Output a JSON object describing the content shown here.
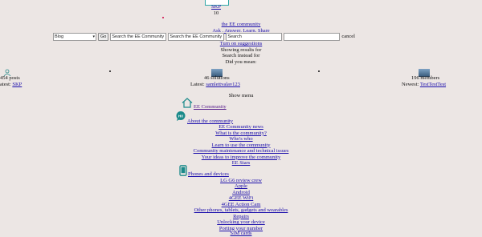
{
  "top": {
    "profile_link": "SKP",
    "profile_count": "10"
  },
  "community": {
    "title_link": "the EE community",
    "tagline": "Ask . Answer. Learn. Share"
  },
  "search": {
    "scope_selected": "Blog",
    "go_label": "Go",
    "field1_value": "Search the EE Community",
    "field2_value": "Search the EE Community",
    "field3_placeholder": "Search",
    "cancel_label": "cancel"
  },
  "suggestions": {
    "toggle_link": "Turn on suggestions",
    "showing_results": "Showing results for",
    "search_instead": "Search instead for",
    "did_you_mean": "Did you mean:"
  },
  "stats": {
    "posts": "454 posts",
    "latest_label_left": "atest:",
    "latest_user_left": "SKP",
    "solutions": "46 solutions",
    "latest_label_mid": "Latest:",
    "latest_user_mid": "samlettvalav123",
    "members": "196 members",
    "newest_label": "Newest:",
    "newest_user": "TestTestTest"
  },
  "menu": {
    "show_menu": "Show menu",
    "ee_community": "EE Community",
    "about_heading": "About the community",
    "about_items": [
      "EE Community news",
      "What is the community?",
      "Who's who",
      "Learn to use the community",
      "Community maintenance and technical issues",
      "Your ideas to improve the community",
      "EE Stars"
    ],
    "phones_heading": "Phones and devices",
    "phones_items": [
      "LG G6 review crew",
      "Apple",
      "Android",
      "4GEE WiFi",
      "4GEE Action Cam",
      "Other phones, tablets, gadgets and wearables",
      "Repairs",
      "Unlocking your device",
      "Porting your number",
      "SIM cards"
    ]
  },
  "icons": {
    "home": "home-icon",
    "chat": "chat-bubble-icon",
    "phone": "phone-icon",
    "accent": "#1a8a8a"
  }
}
